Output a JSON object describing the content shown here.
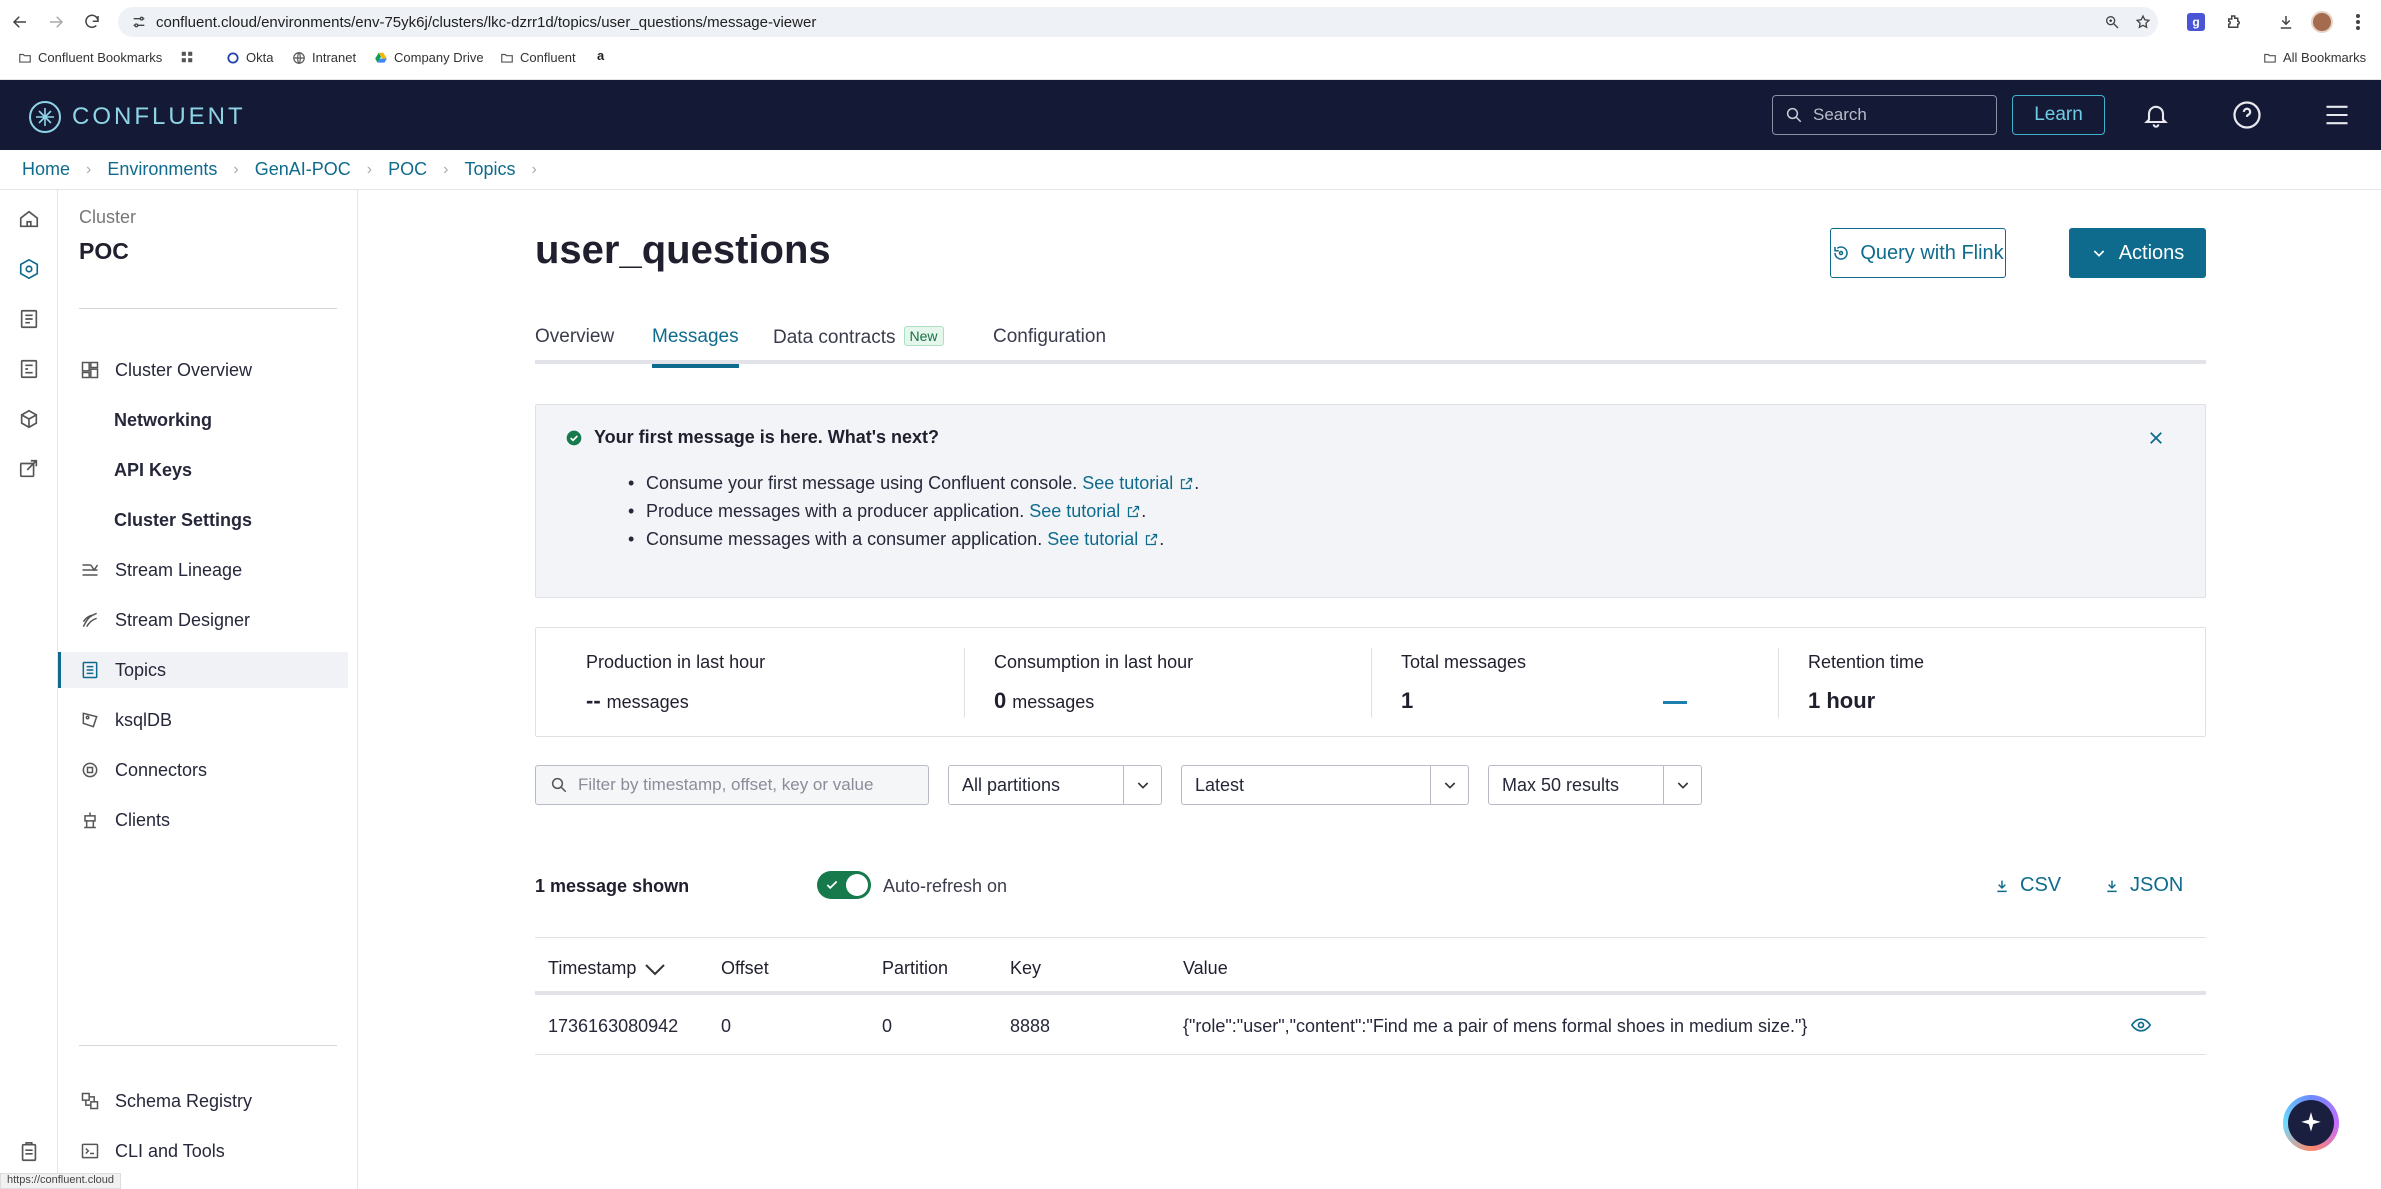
{
  "browser": {
    "url": "confluent.cloud/environments/env-75yk6j/clusters/lkc-dzrr1d/topics/user_questions/message-viewer",
    "bookmarks": [
      "Confluent Bookmarks",
      "Okta",
      "Intranet",
      "Company Drive",
      "Confluent"
    ],
    "all_bookmarks": "All Bookmarks",
    "status_url": "https://confluent.cloud"
  },
  "header": {
    "logo_text": "CONFLUENT",
    "search_placeholder": "Search",
    "learn_label": "Learn"
  },
  "breadcrumb": [
    "Home",
    "Environments",
    "GenAI-POC",
    "POC",
    "Topics"
  ],
  "sidebar": {
    "caption": "Cluster",
    "title": "POC",
    "items": [
      {
        "label": "Cluster Overview",
        "icon": "dashboard-icon"
      },
      {
        "label": "Networking",
        "sub": true
      },
      {
        "label": "API Keys",
        "sub": true
      },
      {
        "label": "Cluster Settings",
        "sub": true
      },
      {
        "label": "Stream Lineage",
        "icon": "lineage-icon"
      },
      {
        "label": "Stream Designer",
        "icon": "designer-icon"
      },
      {
        "label": "Topics",
        "icon": "topics-icon",
        "active": true
      },
      {
        "label": "ksqlDB",
        "icon": "ksqldb-icon"
      },
      {
        "label": "Connectors",
        "icon": "connectors-icon"
      },
      {
        "label": "Clients",
        "icon": "clients-icon"
      }
    ],
    "bottom": [
      {
        "label": "Schema Registry",
        "icon": "schema-icon"
      },
      {
        "label": "CLI and Tools",
        "icon": "terminal-icon"
      }
    ]
  },
  "page": {
    "title": "user_questions",
    "query_button": "Query with Flink",
    "actions_button": "Actions",
    "tabs": [
      "Overview",
      "Messages",
      "Data contracts",
      "Configuration"
    ],
    "new_badge": "New",
    "active_tab": "Messages"
  },
  "banner": {
    "title": "Your first message is here. What's next?",
    "items": [
      {
        "text": "Consume your first message using Confluent console.",
        "link": "See tutorial"
      },
      {
        "text": "Produce messages with a producer application.",
        "link": "See tutorial"
      },
      {
        "text": "Consume messages with a consumer application.",
        "link": "See tutorial"
      }
    ]
  },
  "stats": [
    {
      "label": "Production in last hour",
      "value": "--",
      "unit": "messages"
    },
    {
      "label": "Consumption in last hour",
      "value": "0",
      "unit": "messages"
    },
    {
      "label": "Total messages",
      "value": "1",
      "unit": ""
    },
    {
      "label": "Retention time",
      "value": "1 hour",
      "unit": ""
    }
  ],
  "filters": {
    "search_placeholder": "Filter by timestamp, offset, key or value",
    "partitions": "All partitions",
    "position": "Latest",
    "max_results": "Max 50 results"
  },
  "messages": {
    "count_label": "1 message shown",
    "auto_refresh_label": "Auto-refresh on",
    "csv_label": "CSV",
    "json_label": "JSON",
    "columns": [
      "Timestamp",
      "Offset",
      "Partition",
      "Key",
      "Value"
    ],
    "rows": [
      {
        "timestamp": "1736163080942",
        "offset": "0",
        "partition": "0",
        "key": "8888",
        "value": "{\"role\":\"user\",\"content\":\"Find me a pair of mens formal shoes in medium size.\"}"
      }
    ]
  },
  "colors": {
    "accent": "#0f6b8d",
    "header_bg": "#141a36",
    "toggle_on": "#167a4c"
  }
}
